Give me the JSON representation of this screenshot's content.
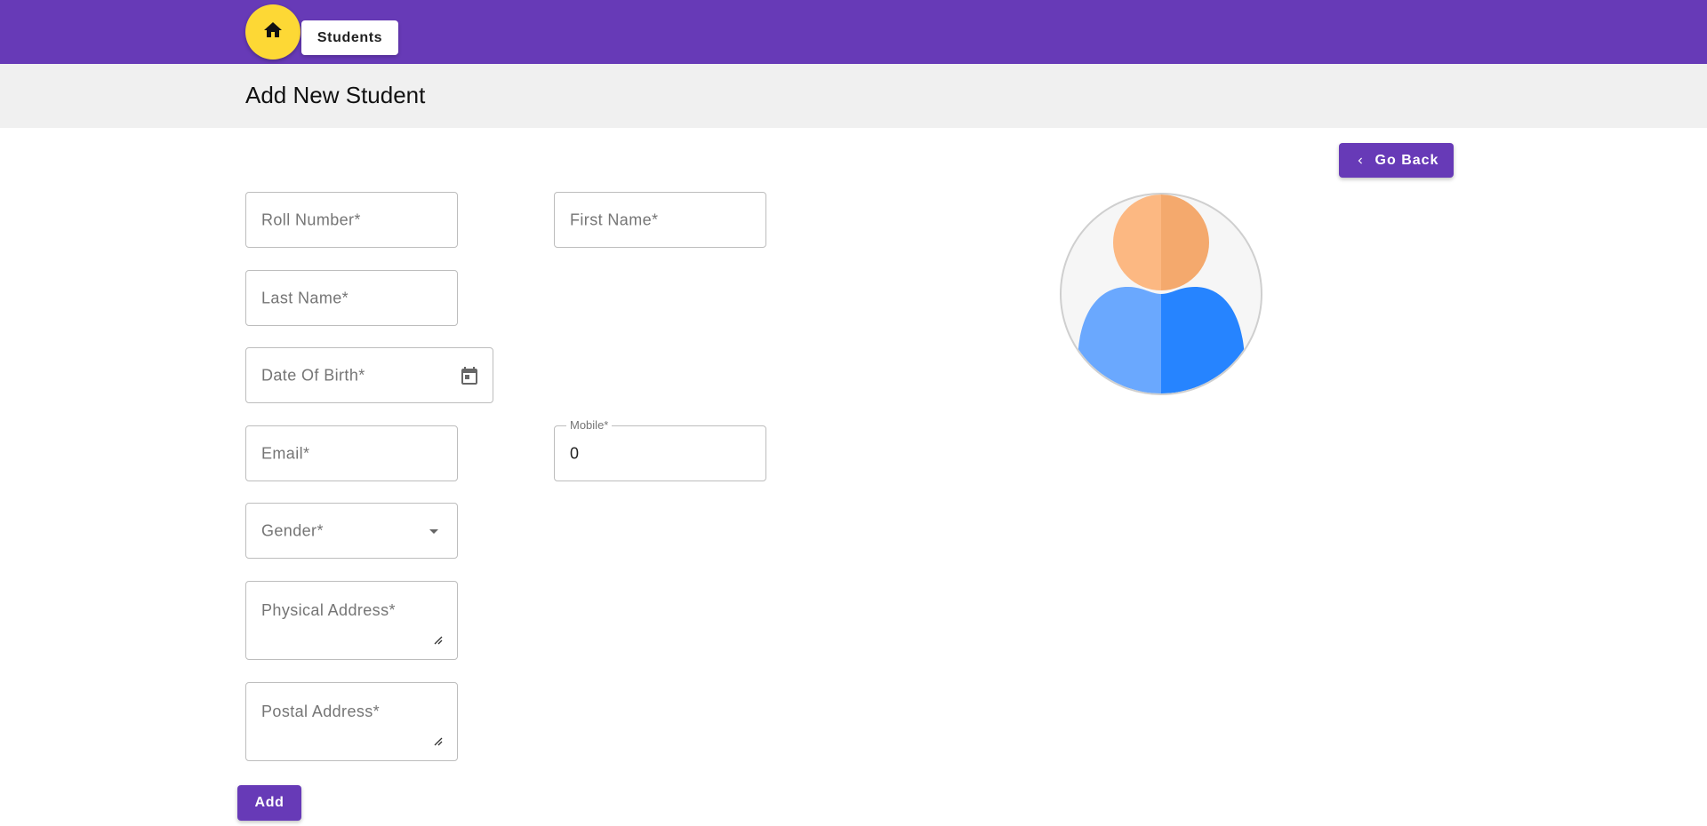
{
  "nav": {
    "home_icon": "home-icon",
    "students_label": "Students"
  },
  "page": {
    "title": "Add New Student"
  },
  "actions": {
    "go_back_label": "Go Back",
    "go_back_icon": "chevron-left-icon",
    "add_label": "Add"
  },
  "form": {
    "roll_number": {
      "placeholder": "Roll Number*",
      "value": ""
    },
    "first_name": {
      "placeholder": "First Name*",
      "value": ""
    },
    "last_name": {
      "placeholder": "Last Name*",
      "value": ""
    },
    "date_of_birth": {
      "placeholder": "Date Of Birth*",
      "value": "",
      "icon": "calendar-icon"
    },
    "email": {
      "placeholder": "Email*",
      "value": ""
    },
    "mobile": {
      "label": "Mobile*",
      "value": "0"
    },
    "gender": {
      "placeholder": "Gender*",
      "value": "",
      "icon": "dropdown-arrow-icon"
    },
    "physical_address": {
      "placeholder": "Physical Address*",
      "value": ""
    },
    "postal_address": {
      "placeholder": "Postal Address*",
      "value": ""
    }
  },
  "colors": {
    "primary": "#673ab7",
    "accent": "#fdd835",
    "title_bar": "#f0f0f0",
    "avatar_skin_light": "#fcb882",
    "avatar_skin_dark": "#f4a96d",
    "avatar_body_light": "#6aa8fe",
    "avatar_body_dark": "#2684ff"
  }
}
